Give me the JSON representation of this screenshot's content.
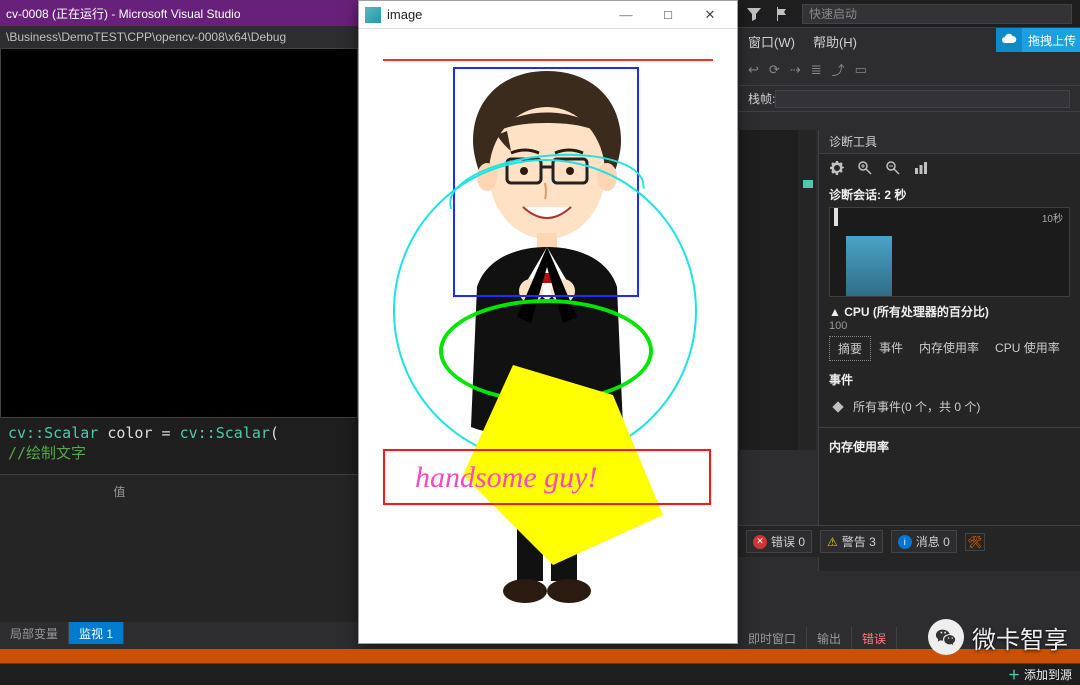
{
  "title_bar": {
    "text": "cv-0008 (正在运行) - Microsoft Visual Studio"
  },
  "path_bar": {
    "text": "\\Business\\DemoTEST\\CPP\\opencv-0008\\x64\\Debug"
  },
  "code": {
    "line": "cv::Scalar color = cv::Scalar(",
    "comment": "//绘制文字"
  },
  "watch": {
    "col_value": "值",
    "tabs": {
      "locals": "局部变量",
      "watch1": "监视 1"
    }
  },
  "right": {
    "quick_launch_placeholder": "快速启动",
    "menu_window": "窗口(W)",
    "menu_help": "帮助(H)",
    "upload": "拖拽上传",
    "stack_label": "栈帧:",
    "diag": {
      "title": "诊断工具",
      "session": "诊断会话: 2 秒",
      "timeline_10s": "10秒",
      "cpu_title": "CPU (所有处理器的百分比)",
      "cpu_100": "100",
      "tabs": {
        "summary": "摘要",
        "events": "事件",
        "mem": "内存使用率",
        "cpu": "CPU 使用率"
      },
      "events_hdr": "事件",
      "events_row": "所有事件(0 个，共 0 个)",
      "mem_hdr": "内存使用率"
    },
    "errorbar": {
      "errors": "错误 0",
      "warnings": "警告 3",
      "messages": "消息 0"
    },
    "output_tabs": {
      "immediate": "即时窗口",
      "output": "输出",
      "errors": "错误"
    }
  },
  "image_window": {
    "title": "image",
    "overlay_text": "handsome guy!"
  },
  "footer": {
    "add": "添加到源"
  },
  "watermark": {
    "text": "微卡智享"
  }
}
